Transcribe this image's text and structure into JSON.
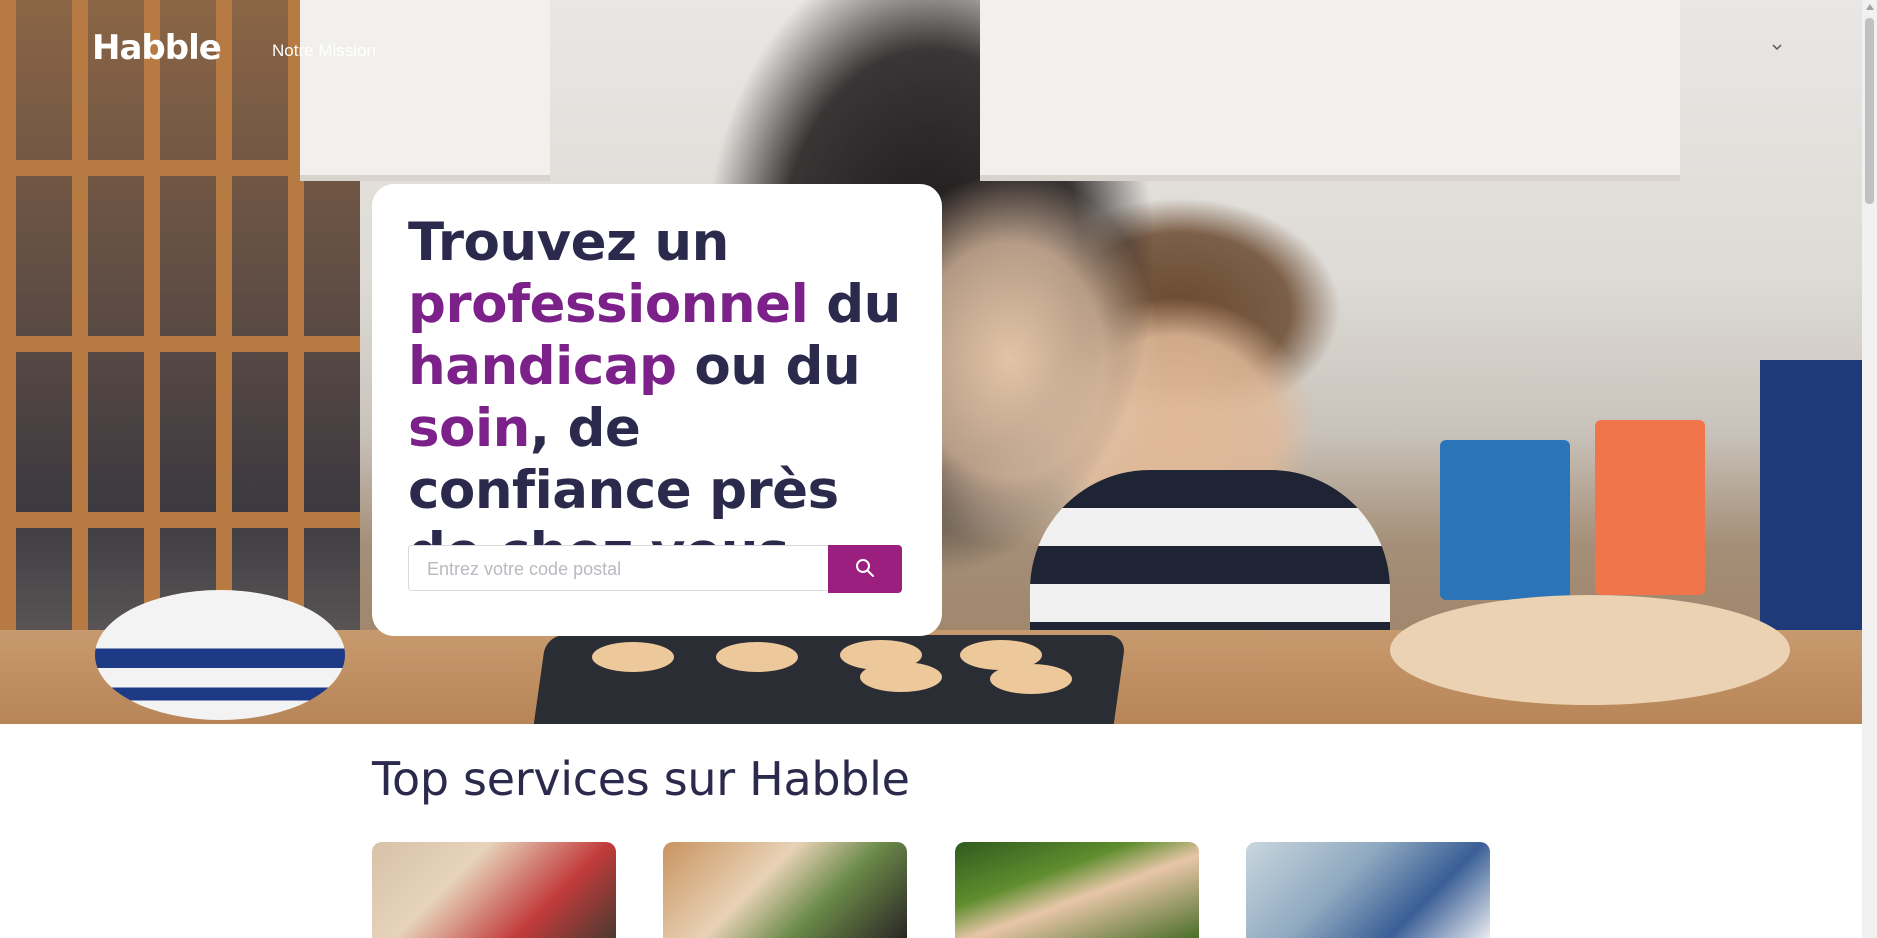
{
  "nav": {
    "logo": "Habble",
    "links": [
      {
        "label": "Notre Mission"
      }
    ],
    "chevron_icon": "chevron-down-icon"
  },
  "hero": {
    "headline": [
      {
        "text": "Trouvez un ",
        "highlight": false
      },
      {
        "text": "professionnel",
        "highlight": true
      },
      {
        "text": " du ",
        "highlight": false
      },
      {
        "text": "handicap",
        "highlight": true
      },
      {
        "text": " ou du ",
        "highlight": false
      },
      {
        "text": "soin",
        "highlight": true
      },
      {
        "text": ", de confiance près de chez vous",
        "highlight": false
      }
    ],
    "search": {
      "placeholder": "Entrez votre code postal",
      "value": "",
      "button_icon": "search-icon"
    }
  },
  "services": {
    "title": "Top services sur Habble",
    "cards": [
      {
        "image": "tutoring-photo"
      },
      {
        "image": "classroom-photo"
      },
      {
        "image": "outdoor-family-photo"
      },
      {
        "image": "adult-care-photo"
      }
    ]
  },
  "colors": {
    "primary_text": "#2b2a4c",
    "highlight": "#7b2189",
    "button": "#9b1f7f",
    "card_background": "#ffffff"
  }
}
